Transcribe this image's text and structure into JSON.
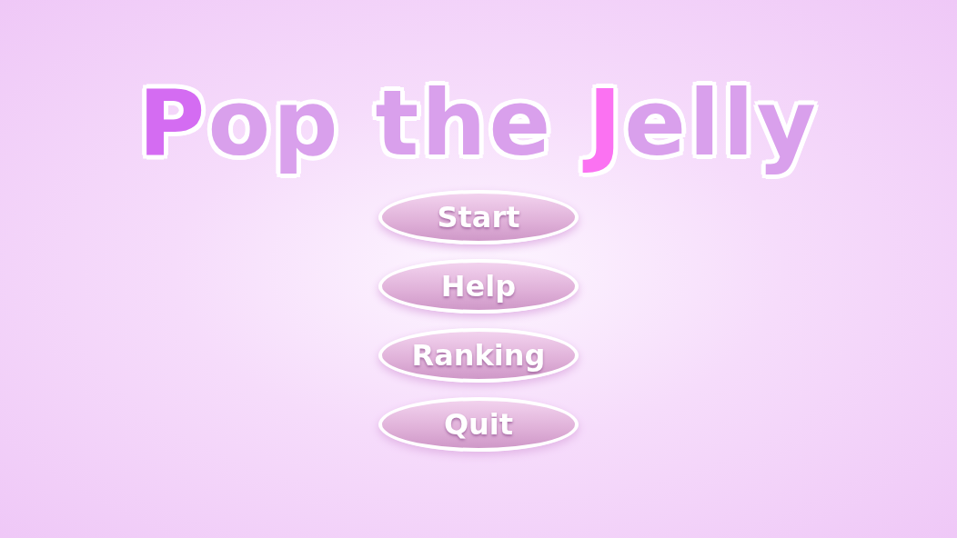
{
  "title": {
    "segments": [
      {
        "text": "P",
        "color": "#d46cf2"
      },
      {
        "text": "op the ",
        "color": "#d9a0ec"
      },
      {
        "text": "J",
        "color": "#fb72f2"
      },
      {
        "text": "elly",
        "color": "#d9a0ec"
      }
    ]
  },
  "menu": [
    {
      "label": "Start"
    },
    {
      "label": "Help"
    },
    {
      "label": "Ranking"
    },
    {
      "label": "Quit"
    }
  ]
}
